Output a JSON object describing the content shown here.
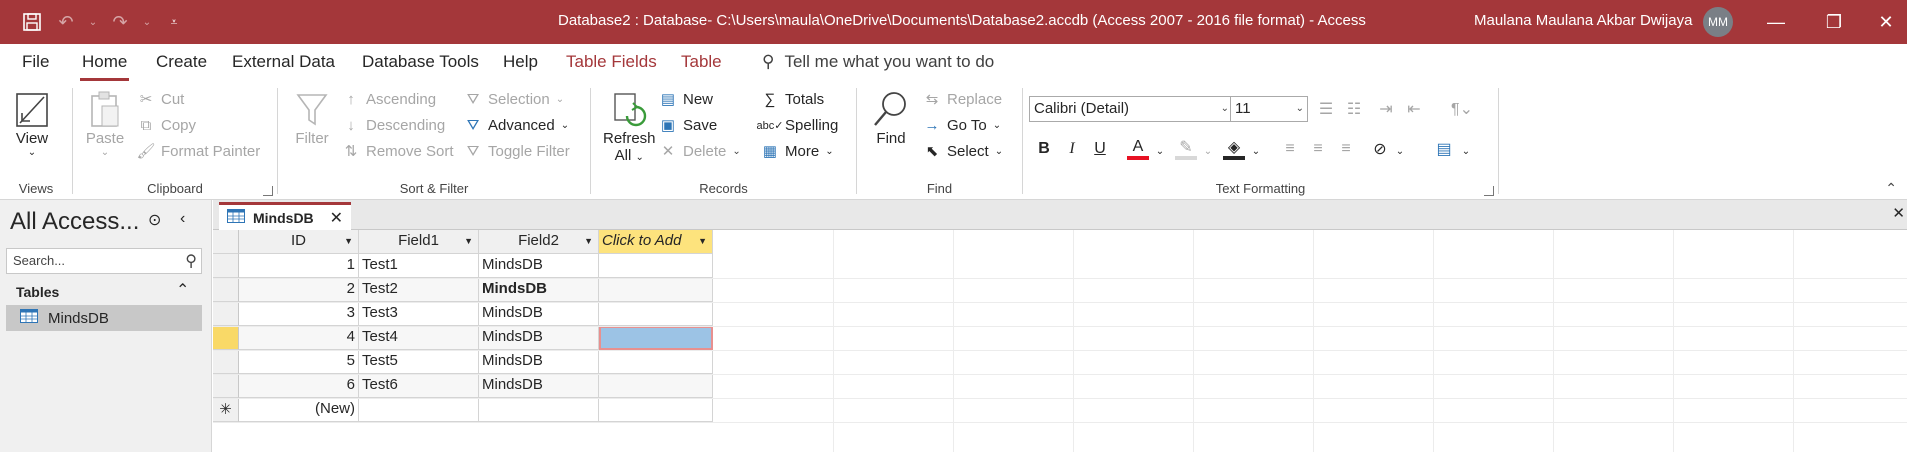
{
  "titlebar": {
    "title": "Database2 : Database- C:\\Users\\maula\\OneDrive\\Documents\\Database2.accdb (Access 2007 - 2016 file format)  -  Access",
    "user": "Maulana Maulana Akbar Dwijaya",
    "avatar_initials": "MM",
    "bg_color": "#a4373a"
  },
  "tabs": {
    "file": "File",
    "home": "Home",
    "create": "Create",
    "external": "External Data",
    "dbtools": "Database Tools",
    "help": "Help",
    "table_fields": "Table Fields",
    "table": "Table",
    "tell_me": "Tell me what you want to do"
  },
  "ribbon": {
    "views": {
      "view": "View",
      "label": "Views"
    },
    "clipboard": {
      "paste": "Paste",
      "cut": "Cut",
      "copy": "Copy",
      "format_painter": "Format Painter",
      "label": "Clipboard"
    },
    "sortfilter": {
      "filter": "Filter",
      "ascending": "Ascending",
      "descending": "Descending",
      "remove_sort": "Remove Sort",
      "selection": "Selection",
      "advanced": "Advanced",
      "toggle_filter": "Toggle Filter",
      "label": "Sort & Filter"
    },
    "records": {
      "refresh": "Refresh",
      "refresh_all": "All",
      "new": "New",
      "save": "Save",
      "delete": "Delete",
      "totals": "Totals",
      "spelling": "Spelling",
      "more": "More",
      "label": "Records"
    },
    "find": {
      "find": "Find",
      "replace": "Replace",
      "goto": "Go To",
      "select": "Select",
      "label": "Find"
    },
    "text": {
      "font": "Calibri (Detail)",
      "size": "11",
      "label": "Text Formatting"
    }
  },
  "nav": {
    "title": "All Access...",
    "search_placeholder": "Search...",
    "section": "Tables",
    "items": [
      {
        "label": "MindsDB"
      }
    ]
  },
  "doc": {
    "tab": "MindsDB",
    "columns": [
      "ID",
      "Field1",
      "Field2",
      "Click to Add"
    ],
    "rows": [
      {
        "id": "1",
        "field1": "Test1",
        "field2": "MindsDB"
      },
      {
        "id": "2",
        "field1": "Test2",
        "field2": "MindsDB"
      },
      {
        "id": "3",
        "field1": "Test3",
        "field2": "MindsDB"
      },
      {
        "id": "4",
        "field1": "Test4",
        "field2": "MindsDB"
      },
      {
        "id": "5",
        "field1": "Test5",
        "field2": "MindsDB"
      },
      {
        "id": "6",
        "field1": "Test6",
        "field2": "MindsDB"
      }
    ],
    "new_row": "(New)"
  }
}
